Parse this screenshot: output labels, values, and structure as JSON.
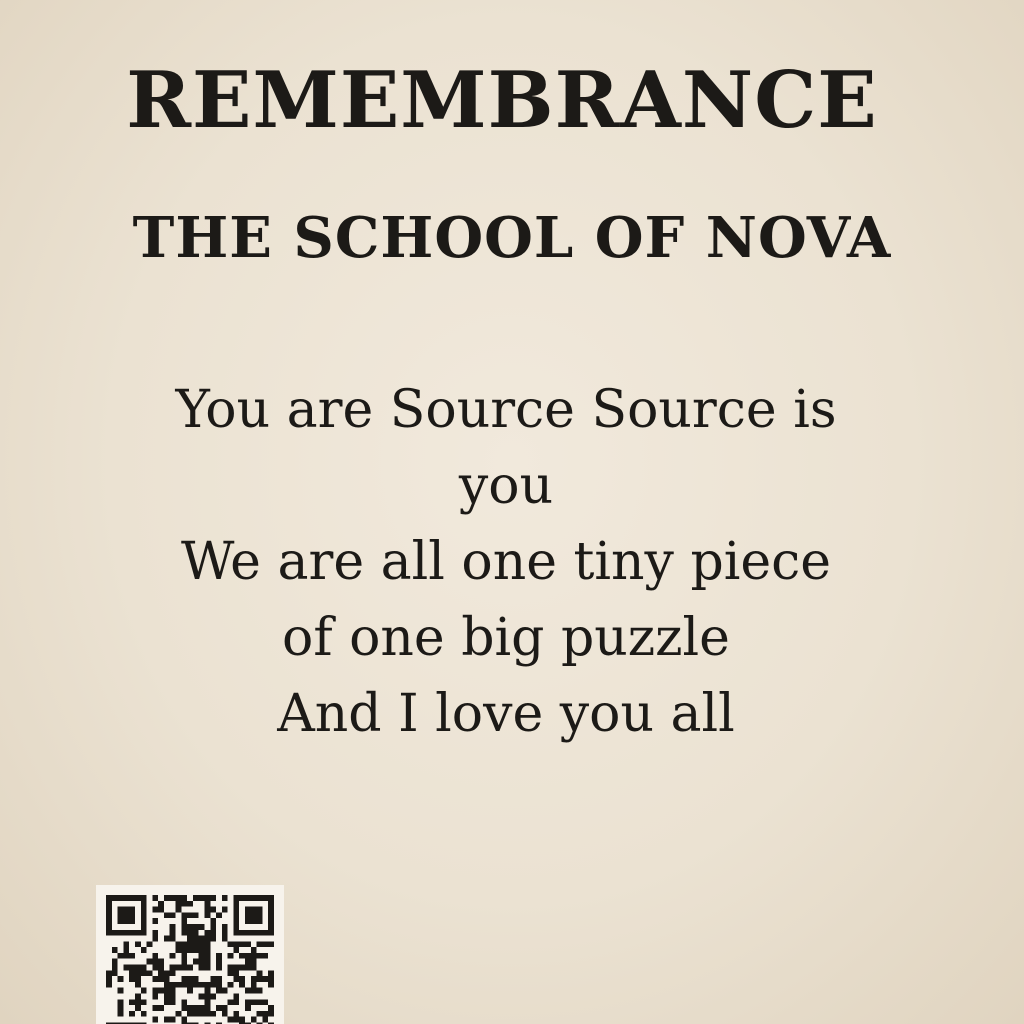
{
  "document": {
    "title": "REMEMBRANCE",
    "subtitle": "THE SCHOOL OF NOVA",
    "poem_lines": [
      "You are Source Source is",
      "you",
      "We are all one tiny piece",
      "of one big puzzle",
      "And I love you all"
    ]
  },
  "colors": {
    "paper": "#ece3d4",
    "ink": "#1c1a17"
  },
  "qr_code": {
    "icon": "qr-code-icon"
  }
}
